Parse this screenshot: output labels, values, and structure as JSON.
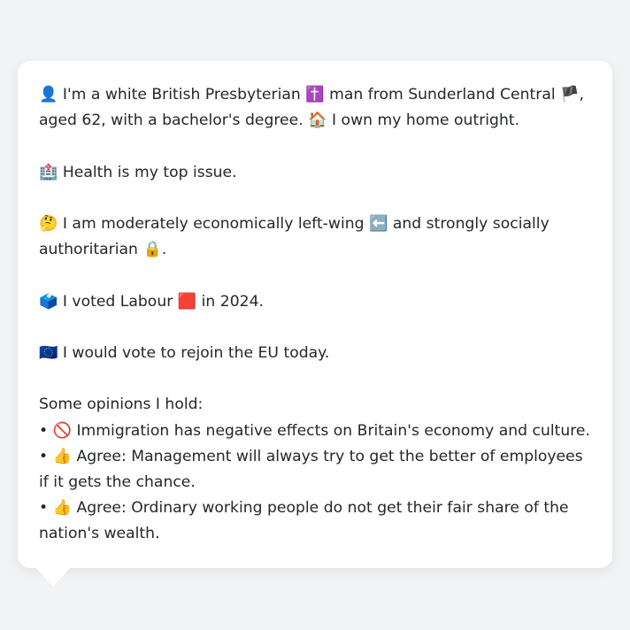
{
  "intro": {
    "icon_person": "👤",
    "text1": "I'm a white British Presbyterian",
    "icon_cross": "✝️",
    "text2": "man from Sunderland Central",
    "icon_flag": "🏴",
    "text3": ", aged 62, with a bachelor's degree.",
    "icon_house": "🏠",
    "text4": "I own my home outright."
  },
  "health": {
    "icon": "🏥",
    "text": "Health is my top issue."
  },
  "politics": {
    "icon_think": "🤔",
    "text1": "I am moderately economically left-wing",
    "icon_arrow": "⬅️",
    "text2": "and strongly socially authoritarian",
    "icon_lock": "🔒",
    "text3": "."
  },
  "vote": {
    "icon_ballot": "🗳️",
    "text1": "I voted Labour",
    "icon_red": "🟥",
    "text2": "in 2024."
  },
  "eu": {
    "icon": "🇪🇺",
    "text": "I would vote to rejoin the EU today."
  },
  "opinions": {
    "heading": "Some opinions I hold:",
    "items": [
      {
        "bullet": "•",
        "icon": "🚫",
        "text": "Immigration has negative effects on Britain's economy and culture."
      },
      {
        "bullet": "•",
        "icon": "👍",
        "text": "Agree: Management will always try to get the better of employees if it gets the chance."
      },
      {
        "bullet": "•",
        "icon": "👍",
        "text": "Agree: Ordinary working people do not get their fair share of the nation's wealth."
      }
    ]
  }
}
